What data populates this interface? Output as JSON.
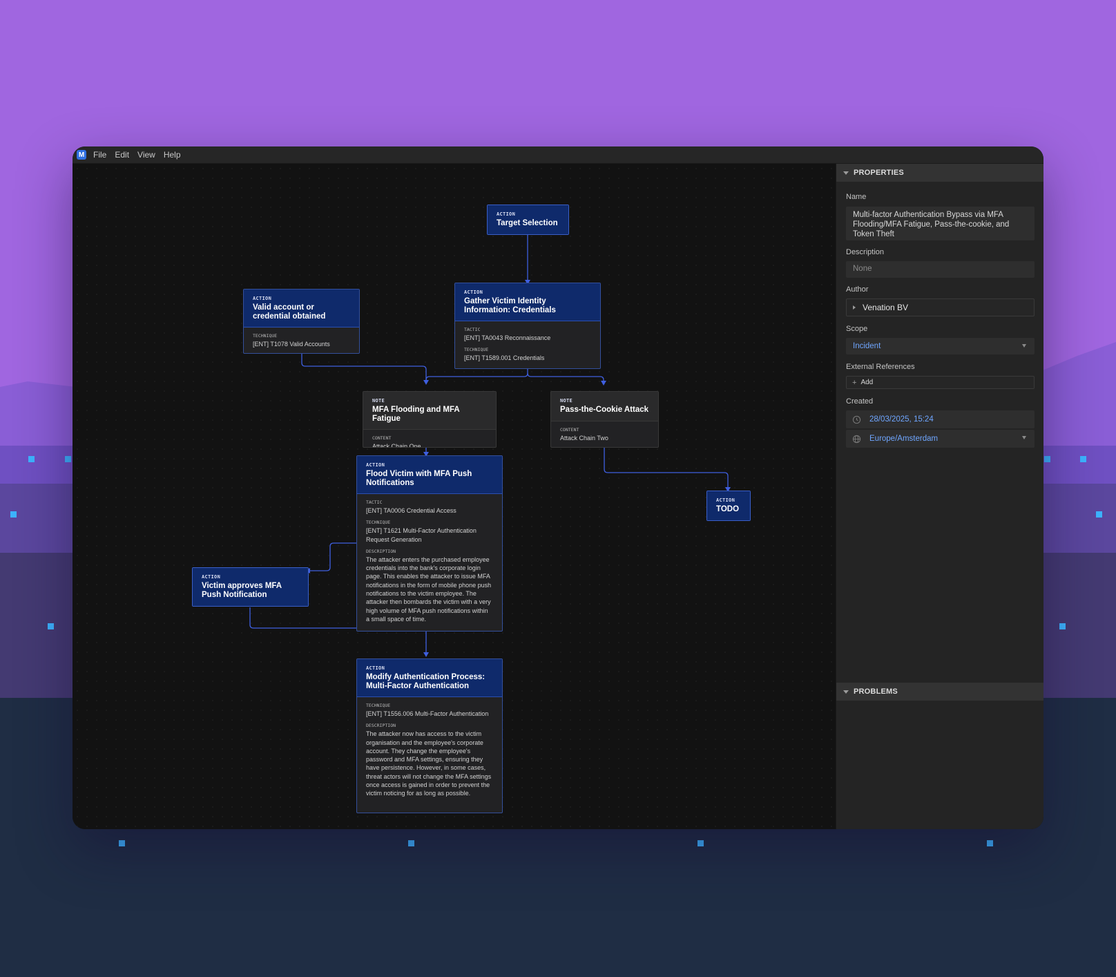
{
  "menubar": {
    "logo_letter": "M",
    "items": [
      "File",
      "Edit",
      "View",
      "Help"
    ]
  },
  "nodes": {
    "target_selection": {
      "type": "Action",
      "title": "Target Selection"
    },
    "valid_account": {
      "type": "Action",
      "title": "Valid account or credential obtained",
      "fields": [
        {
          "label": "Technique",
          "value": "[ENT] T1078 Valid Accounts"
        }
      ]
    },
    "gather_victim": {
      "type": "Action",
      "title": "Gather Victim Identity Information: Credentials",
      "fields": [
        {
          "label": "Tactic",
          "value": "[ENT] TA0043 Reconnaissance"
        },
        {
          "label": "Technique",
          "value": "[ENT] T1589.001 Credentials"
        }
      ]
    },
    "mfa_flooding_note": {
      "type": "Note",
      "title": "MFA Flooding and MFA Fatigue",
      "fields": [
        {
          "label": "Content",
          "value": "Attack Chain One"
        }
      ]
    },
    "pass_cookie_note": {
      "type": "Note",
      "title": "Pass-the-Cookie Attack",
      "fields": [
        {
          "label": "Content",
          "value": "Attack Chain Two"
        }
      ]
    },
    "flood_victim": {
      "type": "Action",
      "title": "Flood Victim with MFA Push Notifications",
      "fields": [
        {
          "label": "Tactic",
          "value": "[ENT] TA0006 Credential Access"
        },
        {
          "label": "Technique",
          "value": "[ENT] T1621 Multi-Factor Authentication Request Generation"
        },
        {
          "label": "Description",
          "value": "The attacker enters the purchased employee credentials into the bank's corporate login page. This enables the attacker to issue MFA notifications in the form of mobile phone push notifications to the victim employee. The attacker then bombards the victim with a very high volume of MFA push notifications within a small space of time."
        }
      ]
    },
    "todo": {
      "type": "Action",
      "title": "TODO"
    },
    "victim_approves": {
      "type": "Action",
      "title": "Victim approves MFA Push Notification"
    },
    "modify_auth": {
      "type": "Action",
      "title": "Modify Authentication Process: Multi-Factor Authentication",
      "fields": [
        {
          "label": "Technique",
          "value": "[ENT] T1556.006 Multi-Factor Authentication"
        },
        {
          "label": "Description",
          "value": "The attacker now has access to the victim organisation and the employee's corporate account. They change the employee's password and MFA settings, ensuring they have persistence. However, in some cases, threat actors will not change the MFA settings once access is gained in order to prevent the victim noticing for as long as possible."
        }
      ]
    }
  },
  "properties": {
    "header": "PROPERTIES",
    "name_label": "Name",
    "name_value": "Multi-factor Authentication Bypass via MFA Flooding/MFA Fatigue, Pass-the-cookie, and Token Theft",
    "description_label": "Description",
    "description_value": "None",
    "author_label": "Author",
    "author_value": "Venation BV",
    "scope_label": "Scope",
    "scope_value": "Incident",
    "extref_label": "External References",
    "extref_add": "Add",
    "created_label": "Created",
    "created_value": "28/03/2025, 15:24",
    "timezone_value": "Europe/Amsterdam"
  },
  "problems": {
    "header": "PROBLEMS"
  },
  "colors": {
    "accent": "#6fa6ff",
    "action_header": "#0f2a6b",
    "edge": "#3f5fe0",
    "background_top": "#a066e0"
  }
}
